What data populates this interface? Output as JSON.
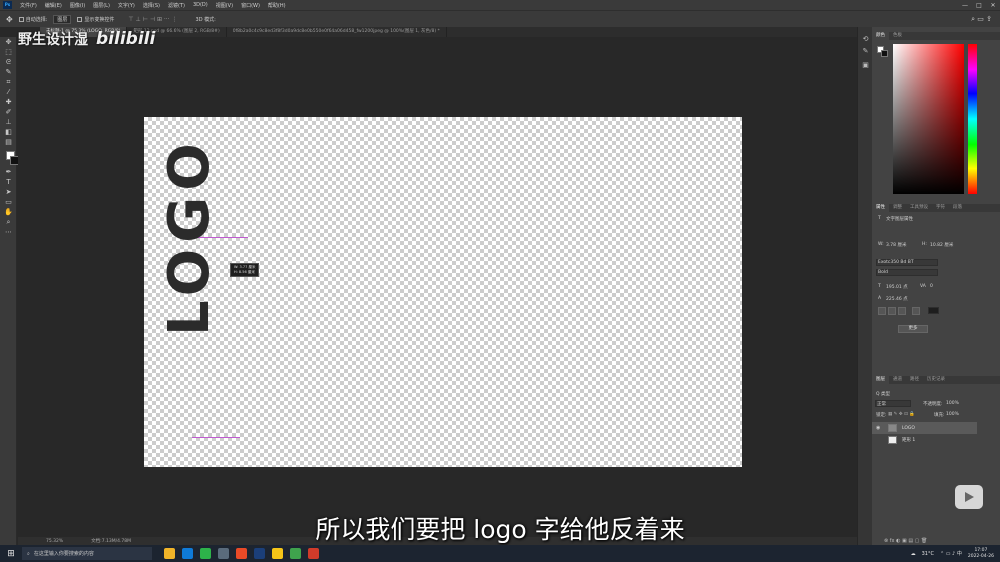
{
  "menubar": {
    "app_icon": "Ps",
    "items": [
      "文件(F)",
      "编辑(E)",
      "图像(I)",
      "图层(L)",
      "文字(Y)",
      "选择(S)",
      "滤镜(T)",
      "3D(D)",
      "视图(V)",
      "窗口(W)",
      "帮助(H)"
    ],
    "minimize": "—",
    "maximize": "□",
    "close": "✕"
  },
  "options": {
    "move_icon": "✥",
    "auto_select_label": "自动选择:",
    "auto_select_value": "图层",
    "show_transform_label": "显示变换控件",
    "align_icons": "⊤ ⊥ ⊢ ⊣ ⊞ ··· ⋮",
    "mode_3d_label": "3D 模式:",
    "right_icons": "⌕ ▭ ⇪"
  },
  "tabs": [
    {
      "label": "未标题-1 @ 75.3% (LOGO, RGB/8)",
      "active": true
    },
    {
      "label": "矩形 12.psd @ 66.6% (图层 2, RGB/8#)",
      "active": false
    },
    {
      "label": "0f8b2a0c4c9c8ed3f8f3d0a9dc8e0b550e0f64a06d458_fw1200jpeg @ 100%(图层 1, 灰色/8) *",
      "active": false
    }
  ],
  "watermark": {
    "text": "野生设计湿",
    "logo": "bilibili"
  },
  "canvas": {
    "logo_text": "LOGO",
    "transform_tooltip": [
      "W: 3.77 厘米",
      "H: 8.56 厘米"
    ]
  },
  "statusbar": {
    "zoom": "75.32%",
    "doc": "文档:7.13M/4.78M"
  },
  "color_panel": {
    "tabs": [
      "颜色",
      "色板"
    ],
    "fg_color": "#ffffff",
    "bg_color": "#111111"
  },
  "properties_panel": {
    "tabs": [
      "属性",
      "调整",
      "工具预设",
      "字符",
      "段落"
    ],
    "type_label": "文字图层属性",
    "w_label": "W:",
    "w_value": "3.78 厘米",
    "h_label": "H:",
    "h_value": "10.82 厘米",
    "font_family": "Exotc350 Bd BT",
    "font_style": "Bold",
    "font_size": "195.01 点",
    "tracking": "0",
    "leading": "225.46 点",
    "more_button": "更多"
  },
  "layers_panel": {
    "tabs": [
      "图层",
      "通道",
      "路径",
      "历史记录"
    ],
    "kind_label": "Q 类型",
    "blend_mode": "正常",
    "opacity_label": "不透明度:",
    "opacity_value": "100%",
    "lock_label": "锁定:",
    "fill_label": "填充:",
    "fill_value": "100%",
    "layers": [
      {
        "name": "LOGO",
        "type": "text",
        "selected": true
      },
      {
        "name": "矩形 1",
        "type": "shape",
        "selected": false
      }
    ]
  },
  "subtitle": "所以我们要把 logo 字给他反着来",
  "taskbar": {
    "search_placeholder": "在这里输入你要搜索的内容",
    "weather": "31°C",
    "time": "17:07",
    "date": "2022-04-26",
    "icon_colors": [
      "#f0b429",
      "#0f7bd8",
      "#2db34a",
      "#5a6b7c",
      "#e84a27",
      "#1b3f7a",
      "#f5c518",
      "#3fa34d",
      "#d03b2a"
    ]
  }
}
